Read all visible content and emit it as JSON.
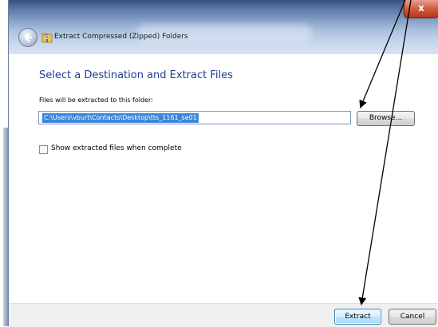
{
  "window": {
    "title": "Extract Compressed (Zipped) Folders",
    "close_label": "x",
    "back_icon": "back-arrow-icon",
    "folder_icon": "zip-folder-icon"
  },
  "content": {
    "heading": "Select a Destination and Extract Files",
    "folder_label": "Files will be extracted to this folder:",
    "path_value": "C:\\Users\\vburt\\Contacts\\Desktop\\tts_1161_se01",
    "browse_label": "Browse...",
    "show_files_label": "Show extracted files when complete",
    "show_files_checked": false
  },
  "footer": {
    "extract_label": "Extract",
    "cancel_label": "Cancel"
  },
  "colors": {
    "heading": "#1e3f8c",
    "selection": "#3c86d9",
    "close_button": "#d35b3c",
    "annotation_arrow": "#000000"
  }
}
